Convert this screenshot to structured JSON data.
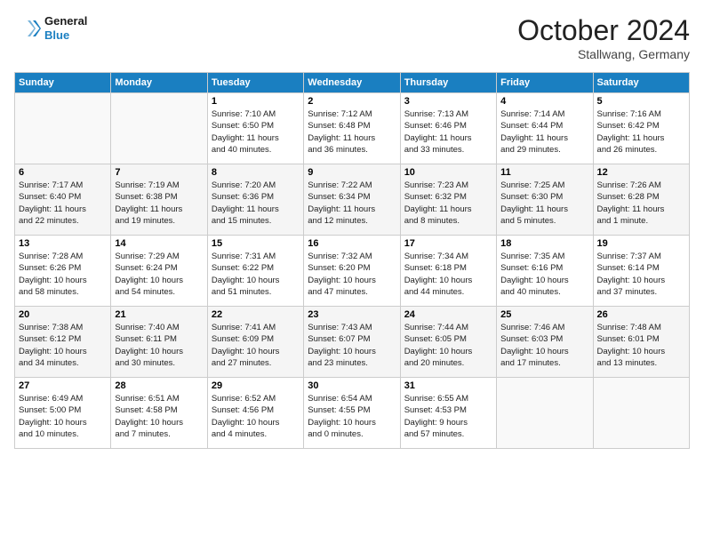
{
  "header": {
    "logo_line1": "General",
    "logo_line2": "Blue",
    "month": "October 2024",
    "location": "Stallwang, Germany"
  },
  "weekdays": [
    "Sunday",
    "Monday",
    "Tuesday",
    "Wednesday",
    "Thursday",
    "Friday",
    "Saturday"
  ],
  "weeks": [
    [
      {
        "day": "",
        "content": ""
      },
      {
        "day": "",
        "content": ""
      },
      {
        "day": "1",
        "content": "Sunrise: 7:10 AM\nSunset: 6:50 PM\nDaylight: 11 hours\nand 40 minutes."
      },
      {
        "day": "2",
        "content": "Sunrise: 7:12 AM\nSunset: 6:48 PM\nDaylight: 11 hours\nand 36 minutes."
      },
      {
        "day": "3",
        "content": "Sunrise: 7:13 AM\nSunset: 6:46 PM\nDaylight: 11 hours\nand 33 minutes."
      },
      {
        "day": "4",
        "content": "Sunrise: 7:14 AM\nSunset: 6:44 PM\nDaylight: 11 hours\nand 29 minutes."
      },
      {
        "day": "5",
        "content": "Sunrise: 7:16 AM\nSunset: 6:42 PM\nDaylight: 11 hours\nand 26 minutes."
      }
    ],
    [
      {
        "day": "6",
        "content": "Sunrise: 7:17 AM\nSunset: 6:40 PM\nDaylight: 11 hours\nand 22 minutes."
      },
      {
        "day": "7",
        "content": "Sunrise: 7:19 AM\nSunset: 6:38 PM\nDaylight: 11 hours\nand 19 minutes."
      },
      {
        "day": "8",
        "content": "Sunrise: 7:20 AM\nSunset: 6:36 PM\nDaylight: 11 hours\nand 15 minutes."
      },
      {
        "day": "9",
        "content": "Sunrise: 7:22 AM\nSunset: 6:34 PM\nDaylight: 11 hours\nand 12 minutes."
      },
      {
        "day": "10",
        "content": "Sunrise: 7:23 AM\nSunset: 6:32 PM\nDaylight: 11 hours\nand 8 minutes."
      },
      {
        "day": "11",
        "content": "Sunrise: 7:25 AM\nSunset: 6:30 PM\nDaylight: 11 hours\nand 5 minutes."
      },
      {
        "day": "12",
        "content": "Sunrise: 7:26 AM\nSunset: 6:28 PM\nDaylight: 11 hours\nand 1 minute."
      }
    ],
    [
      {
        "day": "13",
        "content": "Sunrise: 7:28 AM\nSunset: 6:26 PM\nDaylight: 10 hours\nand 58 minutes."
      },
      {
        "day": "14",
        "content": "Sunrise: 7:29 AM\nSunset: 6:24 PM\nDaylight: 10 hours\nand 54 minutes."
      },
      {
        "day": "15",
        "content": "Sunrise: 7:31 AM\nSunset: 6:22 PM\nDaylight: 10 hours\nand 51 minutes."
      },
      {
        "day": "16",
        "content": "Sunrise: 7:32 AM\nSunset: 6:20 PM\nDaylight: 10 hours\nand 47 minutes."
      },
      {
        "day": "17",
        "content": "Sunrise: 7:34 AM\nSunset: 6:18 PM\nDaylight: 10 hours\nand 44 minutes."
      },
      {
        "day": "18",
        "content": "Sunrise: 7:35 AM\nSunset: 6:16 PM\nDaylight: 10 hours\nand 40 minutes."
      },
      {
        "day": "19",
        "content": "Sunrise: 7:37 AM\nSunset: 6:14 PM\nDaylight: 10 hours\nand 37 minutes."
      }
    ],
    [
      {
        "day": "20",
        "content": "Sunrise: 7:38 AM\nSunset: 6:12 PM\nDaylight: 10 hours\nand 34 minutes."
      },
      {
        "day": "21",
        "content": "Sunrise: 7:40 AM\nSunset: 6:11 PM\nDaylight: 10 hours\nand 30 minutes."
      },
      {
        "day": "22",
        "content": "Sunrise: 7:41 AM\nSunset: 6:09 PM\nDaylight: 10 hours\nand 27 minutes."
      },
      {
        "day": "23",
        "content": "Sunrise: 7:43 AM\nSunset: 6:07 PM\nDaylight: 10 hours\nand 23 minutes."
      },
      {
        "day": "24",
        "content": "Sunrise: 7:44 AM\nSunset: 6:05 PM\nDaylight: 10 hours\nand 20 minutes."
      },
      {
        "day": "25",
        "content": "Sunrise: 7:46 AM\nSunset: 6:03 PM\nDaylight: 10 hours\nand 17 minutes."
      },
      {
        "day": "26",
        "content": "Sunrise: 7:48 AM\nSunset: 6:01 PM\nDaylight: 10 hours\nand 13 minutes."
      }
    ],
    [
      {
        "day": "27",
        "content": "Sunrise: 6:49 AM\nSunset: 5:00 PM\nDaylight: 10 hours\nand 10 minutes."
      },
      {
        "day": "28",
        "content": "Sunrise: 6:51 AM\nSunset: 4:58 PM\nDaylight: 10 hours\nand 7 minutes."
      },
      {
        "day": "29",
        "content": "Sunrise: 6:52 AM\nSunset: 4:56 PM\nDaylight: 10 hours\nand 4 minutes."
      },
      {
        "day": "30",
        "content": "Sunrise: 6:54 AM\nSunset: 4:55 PM\nDaylight: 10 hours\nand 0 minutes."
      },
      {
        "day": "31",
        "content": "Sunrise: 6:55 AM\nSunset: 4:53 PM\nDaylight: 9 hours\nand 57 minutes."
      },
      {
        "day": "",
        "content": ""
      },
      {
        "day": "",
        "content": ""
      }
    ]
  ]
}
